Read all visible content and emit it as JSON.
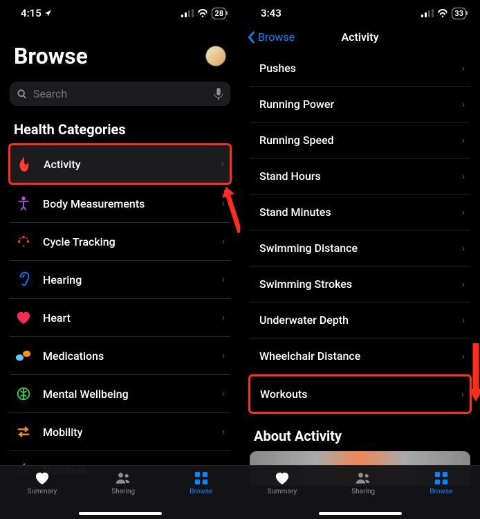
{
  "left": {
    "statusTime": "4:15",
    "locationArrow": "➤",
    "battery": "28",
    "title": "Browse",
    "searchPlaceholder": "Search",
    "sectionTitle": "Health Categories",
    "categories": [
      {
        "label": "Activity",
        "icon": "flame",
        "color": "#ff3b30",
        "highlighted": true
      },
      {
        "label": "Body Measurements",
        "icon": "body",
        "color": "#af52de"
      },
      {
        "label": "Cycle Tracking",
        "icon": "cycle",
        "color": "#ff2d55"
      },
      {
        "label": "Hearing",
        "icon": "ear",
        "color": "#007aff"
      },
      {
        "label": "Heart",
        "icon": "heart",
        "color": "#ff2d55"
      },
      {
        "label": "Medications",
        "icon": "pills",
        "color": "#5ac8fa"
      },
      {
        "label": "Mental Wellbeing",
        "icon": "brain",
        "color": "#30d158"
      },
      {
        "label": "Mobility",
        "icon": "mobility",
        "color": "#ff9500"
      },
      {
        "label": "Nutrition",
        "icon": "apple",
        "color": "#30d158"
      }
    ]
  },
  "right": {
    "statusTime": "3:43",
    "battery": "33",
    "backLabel": "Browse",
    "navTitle": "Activity",
    "items": [
      {
        "label": "Pushes"
      },
      {
        "label": "Running Power"
      },
      {
        "label": "Running Speed"
      },
      {
        "label": "Stand Hours"
      },
      {
        "label": "Stand Minutes"
      },
      {
        "label": "Swimming Distance"
      },
      {
        "label": "Swimming Strokes"
      },
      {
        "label": "Underwater Depth"
      },
      {
        "label": "Wheelchair Distance"
      },
      {
        "label": "Workouts",
        "highlighted": true
      }
    ],
    "aboutTitle": "About Activity"
  },
  "tabs": [
    {
      "label": "Summary",
      "icon": "heart"
    },
    {
      "label": "Sharing",
      "icon": "people"
    },
    {
      "label": "Browse",
      "icon": "grid",
      "active": true
    }
  ]
}
